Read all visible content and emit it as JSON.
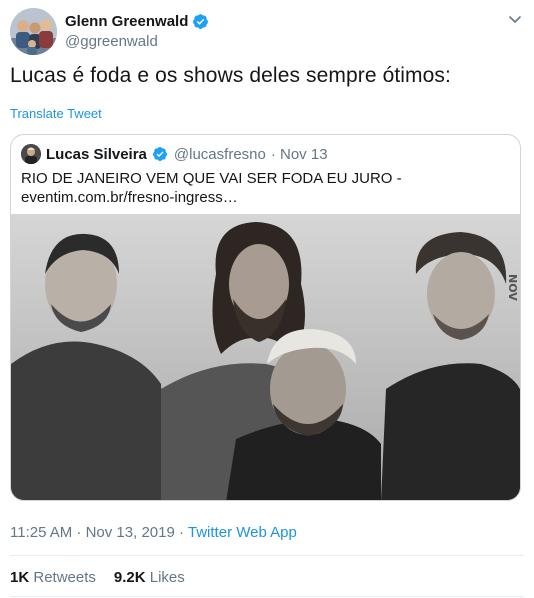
{
  "author": {
    "display_name": "Glenn Greenwald",
    "handle": "@ggreenwald"
  },
  "tweet": {
    "text": "Lucas é foda e os shows deles sempre ótimos:",
    "translate_label": "Translate Tweet",
    "timestamp": "11:25 AM · Nov 13, 2019",
    "separator": " · ",
    "source": "Twitter Web App"
  },
  "quoted": {
    "display_name": "Lucas Silveira",
    "handle": "@lucasfresno",
    "date": "· Nov 13",
    "text": "RIO DE JANEIRO VEM QUE VAI SER FODA EU JURO - eventim.com.br/fresno-ingress…",
    "image_watermark": "NOV"
  },
  "stats": {
    "retweets_count": "1K",
    "retweets_label": "Retweets",
    "likes_count": "9.2K",
    "likes_label": "Likes"
  },
  "colors": {
    "link": "#1b95e0",
    "secondary": "#657786",
    "border": "#ccd6dd"
  },
  "icons": {
    "verified": "verified-badge-icon",
    "menu": "chevron-down-icon"
  }
}
